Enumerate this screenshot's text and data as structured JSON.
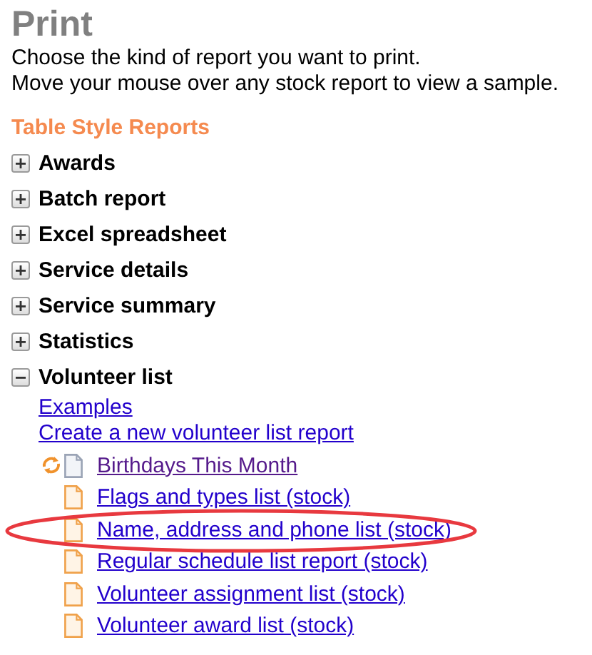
{
  "title": "Print",
  "description": [
    "Choose the kind of report you want to print.",
    "Move your mouse over any stock report to view a sample."
  ],
  "section": {
    "heading": "Table Style Reports",
    "categories": [
      {
        "label": "Awards",
        "expanded": false
      },
      {
        "label": "Batch report",
        "expanded": false
      },
      {
        "label": "Excel spreadsheet",
        "expanded": false
      },
      {
        "label": "Service details",
        "expanded": false
      },
      {
        "label": "Service summary",
        "expanded": false
      },
      {
        "label": "Statistics",
        "expanded": false
      },
      {
        "label": "Volunteer list",
        "expanded": true,
        "links": [
          "Examples",
          "Create a new volunteer list report"
        ],
        "reports": [
          {
            "label": "Birthdays This Month",
            "kind": "custom",
            "visited": true,
            "highlighted": false
          },
          {
            "label": "Flags and types list (stock)",
            "kind": "stock",
            "visited": false,
            "highlighted": false
          },
          {
            "label": "Name, address and phone list (stock)",
            "kind": "stock",
            "visited": false,
            "highlighted": true
          },
          {
            "label": "Regular schedule list report (stock)",
            "kind": "stock",
            "visited": false,
            "highlighted": false
          },
          {
            "label": "Volunteer assignment list (stock)",
            "kind": "stock",
            "visited": false,
            "highlighted": false
          },
          {
            "label": "Volunteer award list (stock)",
            "kind": "stock",
            "visited": false,
            "highlighted": false
          }
        ]
      }
    ]
  }
}
